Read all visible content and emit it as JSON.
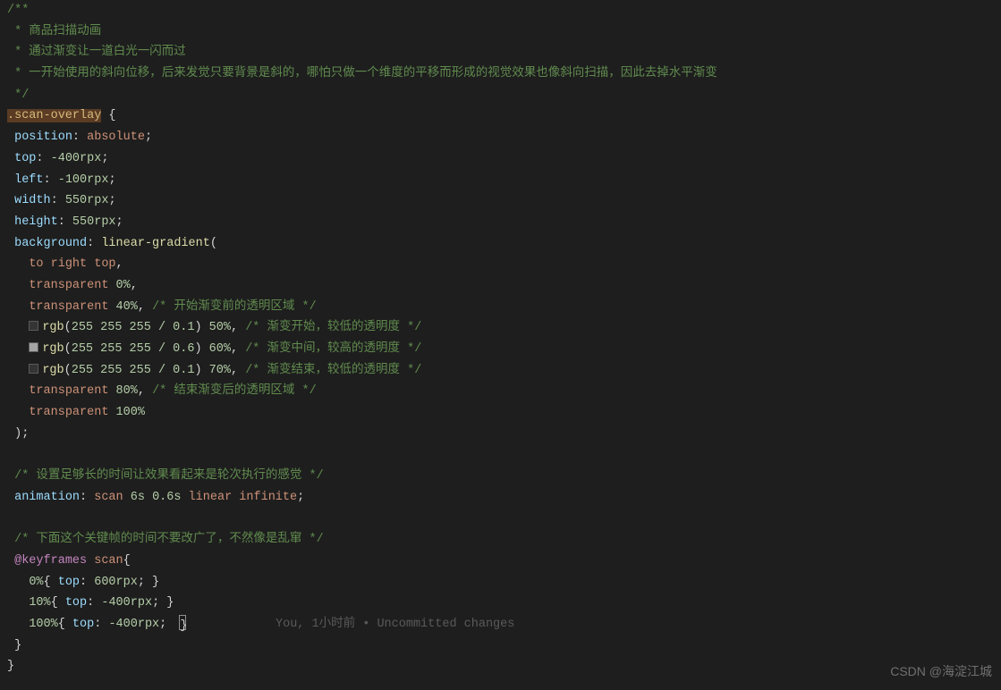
{
  "comment": {
    "start": "/**",
    "l1": " * 商品扫描动画",
    "l2": " * 通过渐变让一道白光一闪而过",
    "l3": " * 一开始使用的斜向位移，后来发觉只要背景是斜的，哪怕只做一个维度的平移而形成的视觉效果也像斜向扫描，因此去掉水平渐变",
    "end": " */"
  },
  "css": {
    "selector": ".scan-overlay",
    "open": " {",
    "props": {
      "position": "position",
      "position_v": "absolute",
      "semi": ";",
      "top": "top",
      "top_v": "-400",
      "top_u": "rpx",
      "left": "left",
      "left_v": "-100",
      "left_u": "rpx",
      "width": "width",
      "width_v": "550",
      "width_u": "rpx",
      "height": "height",
      "height_v": "550",
      "height_u": "rpx",
      "bg": "background",
      "grad": "linear-gradient",
      "paren": "(",
      "dir": "to right top",
      "t0": "transparent",
      "p0": "0%",
      "comma": ",",
      "t40": "transparent",
      "p40": "40%",
      "c40": "/* 开始渐变前的透明区域 */",
      "rgb": "rgb",
      "args": "255 255 255 / ",
      "a1": "0.1",
      "p50": "50%",
      "c50": "/* 渐变开始，较低的透明度 */",
      "a2": "0.6",
      "p60": "60%",
      "c60": "/* 渐变中间，较高的透明度 */",
      "a3": "0.1",
      "p70": "70%",
      "c70": "/* 渐变结束，较低的透明度 */",
      "t80": "transparent",
      "p80": "80%",
      "c80": "/* 结束渐变后的透明区域 */",
      "t100": "transparent",
      "p100": "100%",
      "close_paren": ");",
      "anim_c": "/* 设置足够长的时间让效果看起来是轮次执行的感觉 */",
      "anim": "animation",
      "anim_v1": "scan",
      "anim_v2": "6s",
      "anim_v3": "0.6s",
      "anim_v4": "linear",
      "anim_v5": "infinite",
      "kf_c": "/* 下面这个关键帧的时间不要改广了，不然像是乱窜 */",
      "at": "@keyframes",
      "kf_name": "scan",
      "kf_open": "{",
      "kf0": "0%",
      "kf_top": "top",
      "kf0_v": "600",
      "kf10": "10%",
      "kf10_v": "-400",
      "kf100": "100%",
      "kf100_v": "-400",
      "rpx": "rpx",
      "close_b": "}"
    }
  },
  "gitlens": {
    "author": "You, ",
    "time": "1小时前",
    "sep": " • ",
    "msg": "Uncommitted changes"
  },
  "watermark": "CSDN @海淀江城"
}
